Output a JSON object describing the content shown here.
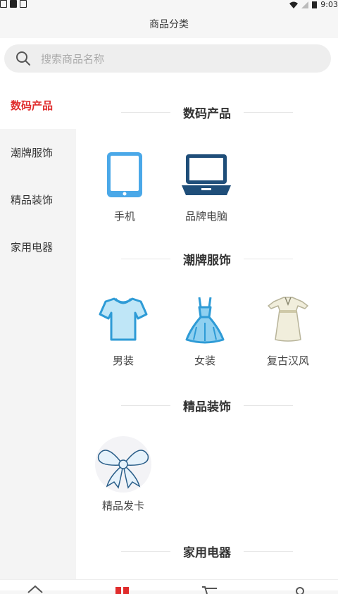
{
  "status": {
    "time": "9:03"
  },
  "header": {
    "title": "商品分类"
  },
  "search": {
    "placeholder": "搜索商品名称"
  },
  "sidebar": {
    "items": [
      {
        "label": "数码产品"
      },
      {
        "label": "潮牌服饰"
      },
      {
        "label": "精品装饰"
      },
      {
        "label": "家用电器"
      }
    ]
  },
  "sections": [
    {
      "title": "数码产品",
      "items": [
        {
          "label": "手机",
          "icon": "tablet-icon"
        },
        {
          "label": "品牌电脑",
          "icon": "laptop-icon"
        }
      ]
    },
    {
      "title": "潮牌服饰",
      "items": [
        {
          "label": "男装",
          "icon": "tshirt-icon"
        },
        {
          "label": "女装",
          "icon": "dress-icon"
        },
        {
          "label": "复古汉风",
          "icon": "hanfu-icon"
        }
      ]
    },
    {
      "title": "精品装饰",
      "items": [
        {
          "label": "精品发卡",
          "icon": "bow-icon"
        }
      ]
    },
    {
      "title": "家用电器",
      "items": []
    }
  ],
  "colors": {
    "accent": "#e02d2d",
    "icon_blue": "#4aa8e8",
    "dark_blue": "#1f4e79"
  }
}
